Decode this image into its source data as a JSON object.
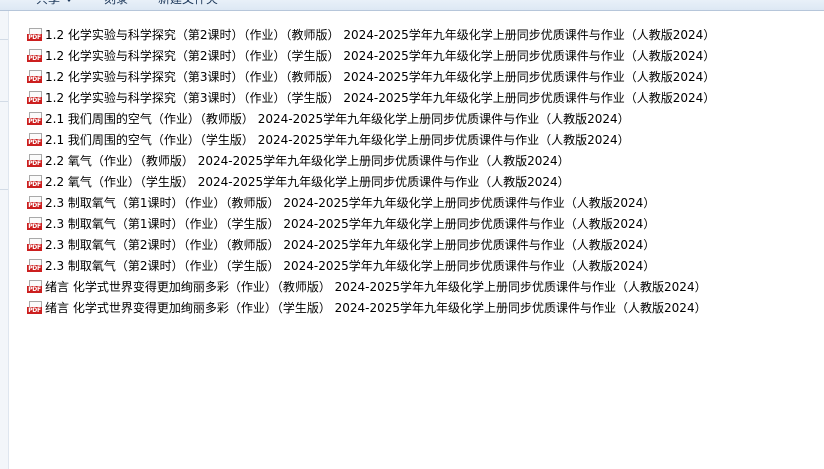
{
  "toolbar": {
    "share_label": "共享",
    "burn_label": "刻录",
    "new_folder_label": "新建文件夹"
  },
  "icons": {
    "file_type": "pdf-icon",
    "file_badge_text": "PDF",
    "badge_color": "#cc1f1f"
  },
  "files": [
    {
      "name": "1.2 化学实验与科学探究（第2课时）（作业）（教师版） 2024-2025学年九年级化学上册同步优质课件与作业（人教版2024）"
    },
    {
      "name": "1.2 化学实验与科学探究（第2课时）（作业）（学生版） 2024-2025学年九年级化学上册同步优质课件与作业（人教版2024）"
    },
    {
      "name": "1.2 化学实验与科学探究（第3课时）（作业）（教师版） 2024-2025学年九年级化学上册同步优质课件与作业（人教版2024）"
    },
    {
      "name": "1.2 化学实验与科学探究（第3课时）（作业）（学生版） 2024-2025学年九年级化学上册同步优质课件与作业（人教版2024）"
    },
    {
      "name": "2.1 我们周围的空气（作业）（教师版） 2024-2025学年九年级化学上册同步优质课件与作业（人教版2024）"
    },
    {
      "name": "2.1 我们周围的空气（作业）（学生版） 2024-2025学年九年级化学上册同步优质课件与作业（人教版2024）"
    },
    {
      "name": "2.2 氧气（作业）（教师版） 2024-2025学年九年级化学上册同步优质课件与作业（人教版2024）"
    },
    {
      "name": "2.2 氧气（作业）（学生版） 2024-2025学年九年级化学上册同步优质课件与作业（人教版2024）"
    },
    {
      "name": "2.3 制取氧气（第1课时）（作业）（教师版） 2024-2025学年九年级化学上册同步优质课件与作业（人教版2024）"
    },
    {
      "name": "2.3 制取氧气（第1课时）（作业）（学生版） 2024-2025学年九年级化学上册同步优质课件与作业（人教版2024）"
    },
    {
      "name": "2.3 制取氧气（第2课时）（作业）（教师版） 2024-2025学年九年级化学上册同步优质课件与作业（人教版2024）"
    },
    {
      "name": "2.3 制取氧气（第2课时）（作业）（学生版） 2024-2025学年九年级化学上册同步优质课件与作业（人教版2024）"
    },
    {
      "name": "绪言 化学式世界变得更加绚丽多彩（作业）（教师版） 2024-2025学年九年级化学上册同步优质课件与作业（人教版2024）"
    },
    {
      "name": "绪言 化学式世界变得更加绚丽多彩（作业）（学生版） 2024-2025学年九年级化学上册同步优质课件与作业（人教版2024）"
    }
  ]
}
